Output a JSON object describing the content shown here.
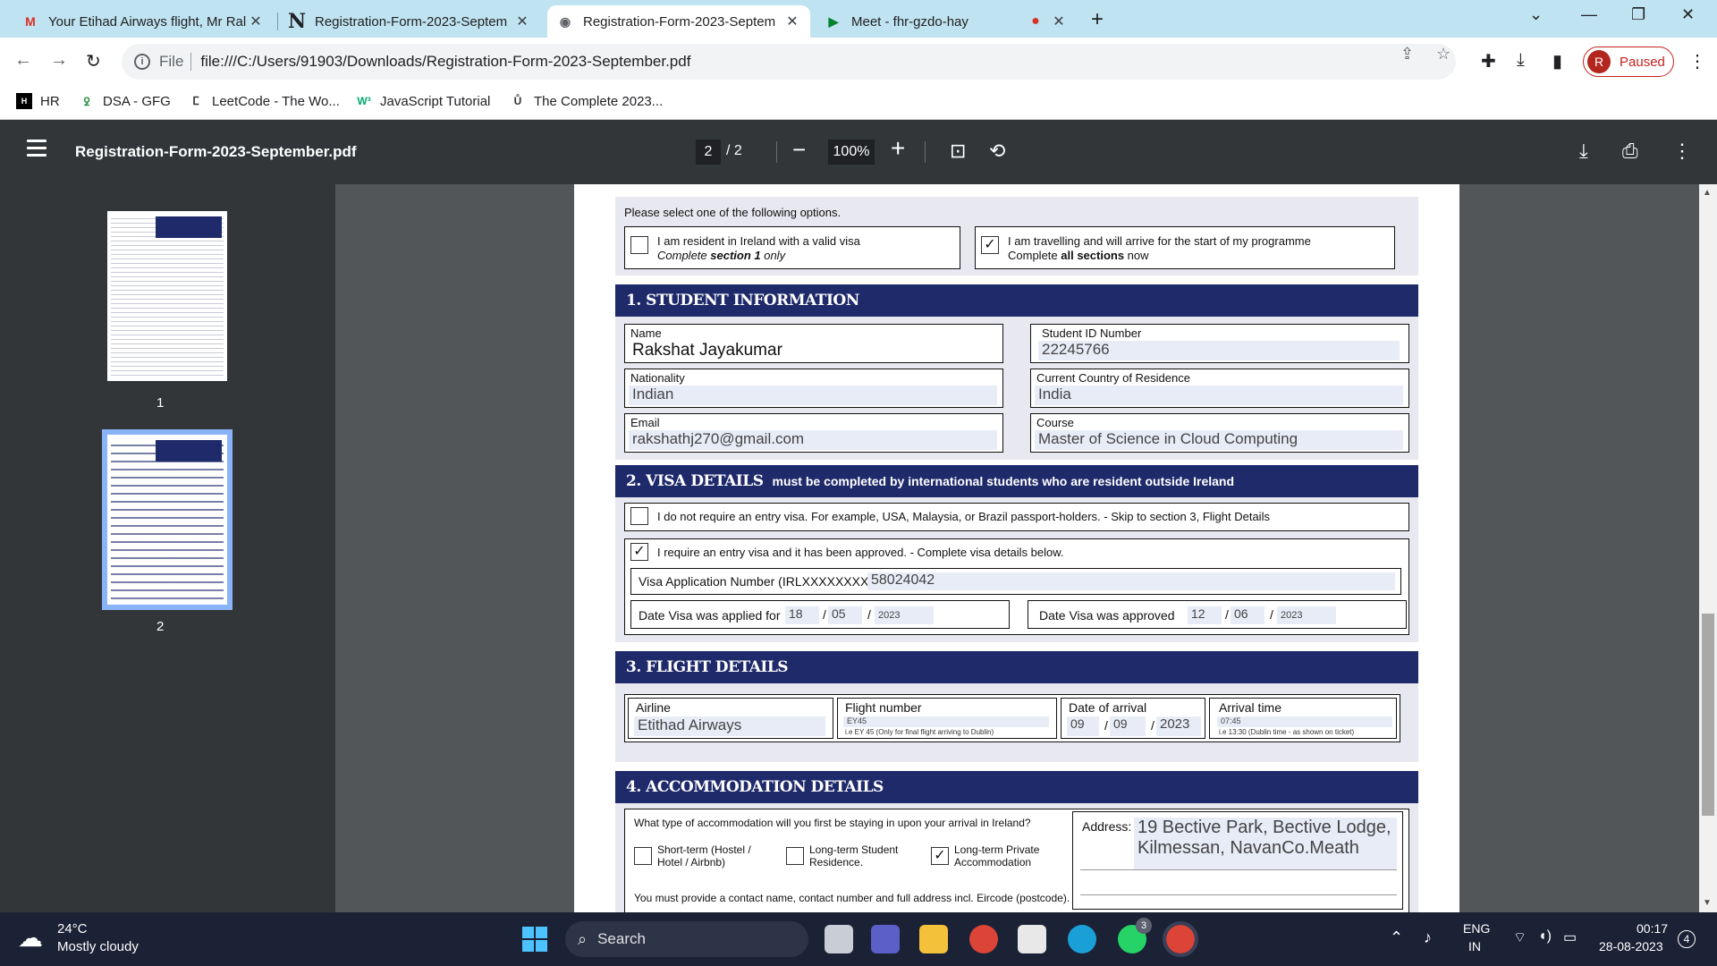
{
  "browser": {
    "tabs": [
      {
        "title": "Your Etihad Airways flight, Mr Ral",
        "icon": "M"
      },
      {
        "title": "Registration-Form-2023-Septem",
        "icon": "N"
      },
      {
        "title": "Registration-Form-2023-Septem",
        "icon": "globe"
      },
      {
        "title": "Meet - fhr-gzdo-hay",
        "icon": "meet"
      }
    ],
    "file_label": "File",
    "url": "file:///C:/Users/91903/Downloads/Registration-Form-2023-September.pdf",
    "profile_initial": "R",
    "profile_status": "Paused",
    "bookmarks": [
      {
        "label": "HR",
        "icon": "HR"
      },
      {
        "label": "DSA - GFG",
        "icon": "GfG"
      },
      {
        "label": "LeetCode - The Wo...",
        "icon": "LC"
      },
      {
        "label": "JavaScript Tutorial",
        "icon": "W3"
      },
      {
        "label": "The Complete 2023...",
        "icon": "U"
      }
    ]
  },
  "pdf_toolbar": {
    "title": "Registration-Form-2023-September.pdf",
    "current_page": "2",
    "total_pages": "/ 2",
    "zoom": "100%"
  },
  "thumbnails": [
    {
      "number": "1"
    },
    {
      "number": "2"
    }
  ],
  "form": {
    "options_prompt": "Please select one of the following options.",
    "option1_line1": "I am resident in Ireland with a valid visa",
    "option1_line2_a": "Complete ",
    "option1_line2_b": "section 1",
    "option1_line2_c": " only",
    "option2_line1": "I am travelling and will arrive for the start of my programme",
    "option2_line2_a": "Complete ",
    "option2_line2_b": "all sections",
    "option2_line2_c": " now",
    "s1_title": "1. STUDENT INFORMATION",
    "name_label": "Name",
    "name_value": "Rakshat Jayakumar",
    "student_id_label": "Student ID Number",
    "student_id_value": "22245766",
    "nationality_label": "Nationality",
    "nationality_value": "Indian",
    "country_label": "Current Country of Residence",
    "country_value": "India",
    "email_label": "Email",
    "email_value": "rakshathj270@gmail.com",
    "course_label": "Course",
    "course_value": "Master of Science in Cloud Computing",
    "s2_title": "2. VISA DETAILS",
    "s2_sub": "must be completed by international students who are resident outside Ireland",
    "visa_no_req": "I do not require an entry visa. For example, USA, Malaysia, or Brazil passport-holders. - Skip to section 3, Flight Details",
    "visa_req": "I require an entry visa and it has been approved. - Complete visa details below.",
    "visa_app_label": "Visa Application Number (IRLXXXXXXXX):",
    "visa_app_value": "58024042",
    "visa_applied_label": "Date Visa was applied for",
    "visa_applied_dd": "18",
    "visa_applied_mm": "05",
    "visa_applied_yy": "2023",
    "visa_approved_label": "Date Visa was approved",
    "visa_approved_dd": "12",
    "visa_approved_mm": "06",
    "visa_approved_yy": "2023",
    "slash": "/",
    "s3_title": "3. FLIGHT DETAILS",
    "airline_label": "Airline",
    "airline_value": "Etithad Airways",
    "flight_label": "Flight number",
    "flight_value": "EY45",
    "flight_hint": "i.e EY 45 (Only for final flight arriving to Dublin)",
    "arrival_date_label": "Date of arrival",
    "arrival_dd": "09",
    "arrival_mm": "09",
    "arrival_yy": "2023",
    "arrival_time_label": "Arrival time",
    "arrival_time_value": "07:45",
    "arrival_time_hint": "i.e 13:30 (Dublin time - as shown on ticket)",
    "s4_title": "4. ACCOMMODATION DETAILS",
    "accom_prompt": "What type of accommodation will you first be staying in upon your arrival in Ireland?",
    "accom_opt1": "Short-term (Hostel / Hotel / Airbnb)",
    "accom_opt2": "Long-term Student Residence.",
    "accom_opt3": "Long-term Private Accommodation",
    "address_label": "Address:",
    "address_line1": "19 Bective Park, Bective Lodge,",
    "address_line2": "Kilmessan, NavanCo.Meath",
    "accom_note": "You must provide a contact name, contact number and full address incl. Eircode (postcode)."
  },
  "taskbar": {
    "temperature": "24°C",
    "weather": "Mostly cloudy",
    "search_placeholder": "Search",
    "lang1": "ENG",
    "lang2": "IN",
    "time": "00:17",
    "date": "28-08-2023",
    "notif_count": "4",
    "whatsapp_badge": "3"
  },
  "colors": {
    "section_header": "#1f2a6b",
    "tab_strip": "#bfe3f0",
    "pdf_bg": "#525659",
    "field_fill": "#e8ecf7"
  }
}
